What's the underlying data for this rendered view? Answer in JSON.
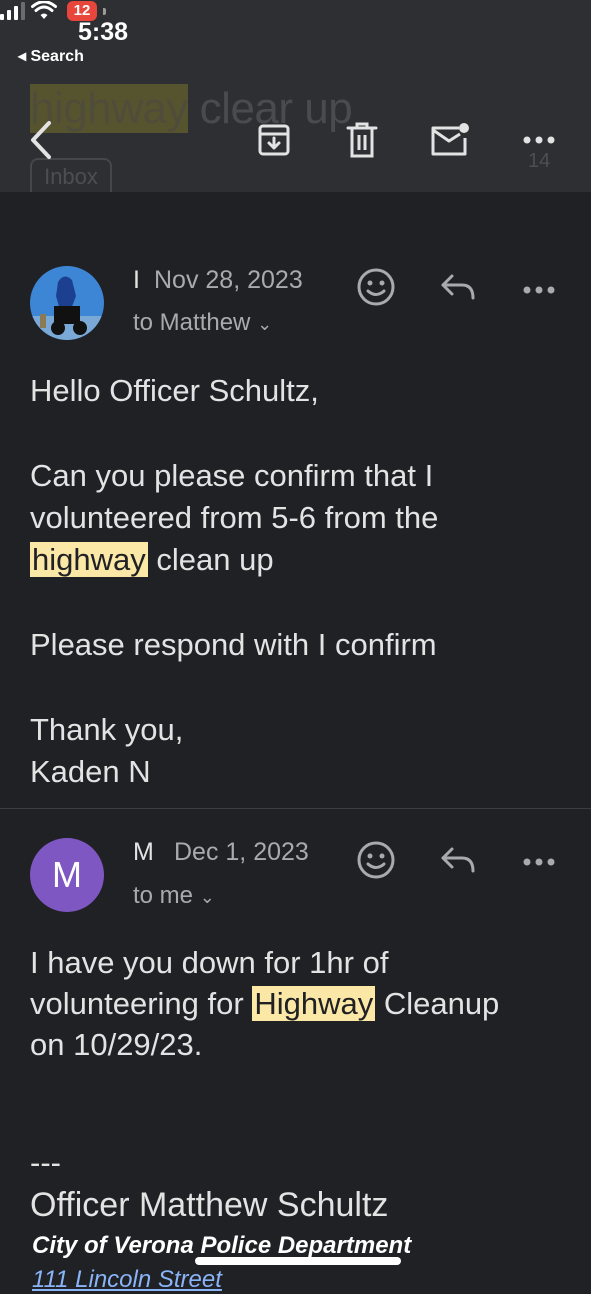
{
  "status_bar": {
    "time": "5:38",
    "back_app": "Search",
    "battery": "12"
  },
  "header": {
    "subject_parts": [
      "highway",
      " ",
      "clear up"
    ],
    "label": "Inbox",
    "count": "14"
  },
  "messages": [
    {
      "sender": "I",
      "date": "Nov 28, 2023",
      "recipient": "to Matthew",
      "body": {
        "greeting": "Hello Officer Schultz,",
        "line1": "Can you please confirm that I",
        "line2": "volunteered from 5-6 from the",
        "highlight": "highway",
        "line3_rest": " clean up",
        "line4": "Please respond with I confirm",
        "closing": "Thank you,",
        "signoff": "Kaden N"
      }
    },
    {
      "sender": "M",
      "avatar_letter": "M",
      "date": "Dec 1, 2023",
      "recipient": "to me",
      "body": {
        "line1": "I have you down for 1hr of",
        "line2_pre": "volunteering for ",
        "highlight": "Highway",
        "line2_post": " Cleanup",
        "line3": "on 10/29/23.",
        "sig_sep": "---",
        "sig_name": "Officer Matthew Schultz",
        "sig_dept": "City of Verona Police Department",
        "sig_street": "111 Lincoln Street"
      }
    }
  ],
  "colors": {
    "background": "#202124",
    "toolbar": "#2e2f32",
    "highlight": "#fce8a6",
    "avatar_m": "#7e57c2",
    "link": "#8ab4f8"
  },
  "icons": [
    "back-chevron-icon",
    "archive-icon",
    "trash-icon",
    "mark-unread-icon",
    "more-icon",
    "emoji-icon",
    "reply-icon"
  ]
}
